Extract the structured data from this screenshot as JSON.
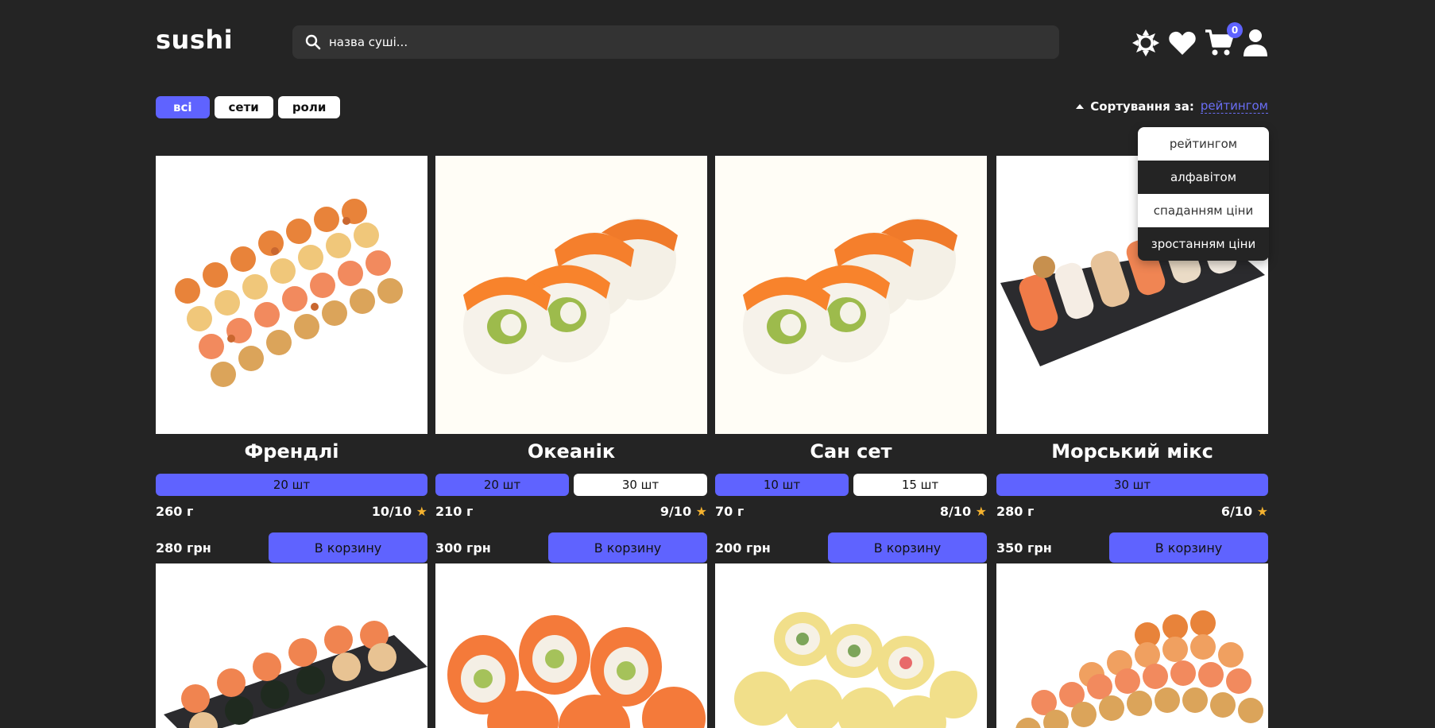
{
  "header": {
    "logo": "sushi",
    "search_placeholder": "назва суші...",
    "cart_count": "0"
  },
  "filters": [
    {
      "label": "всі",
      "active": true
    },
    {
      "label": "сети",
      "active": false
    },
    {
      "label": "роли",
      "active": false
    }
  ],
  "sort": {
    "label": "Сортування за:",
    "value": "рейтингом",
    "options": [
      "рейтингом",
      "алфавітом",
      "спаданням ціни",
      "зростанням ціни"
    ]
  },
  "products": [
    {
      "name": "Френдлі",
      "sizes": [
        "20 шт"
      ],
      "weight": "260 г",
      "rating": "10/10",
      "price": "280 грн",
      "button": "В корзину"
    },
    {
      "name": "Океанік",
      "sizes": [
        "20 шт",
        "30 шт"
      ],
      "weight": "210 г",
      "rating": "9/10",
      "price": "300 грн",
      "button": "В корзину"
    },
    {
      "name": "Сан сет",
      "sizes": [
        "10 шт",
        "15 шт"
      ],
      "weight": "70 г",
      "rating": "8/10",
      "price": "200 грн",
      "button": "В корзину"
    },
    {
      "name": "Морський мікс",
      "sizes": [
        "30 шт"
      ],
      "weight": "280 г",
      "rating": "6/10",
      "price": "350 грн",
      "button": "В корзину"
    }
  ],
  "icons": {
    "star": "★",
    "theme": "sun-icon",
    "favorites": "heart-icon",
    "cart": "cart-icon",
    "profile": "user-icon",
    "search": "search-icon"
  },
  "colors": {
    "accent": "#5f63ff",
    "background": "#242424",
    "star": "#f4b22f"
  }
}
